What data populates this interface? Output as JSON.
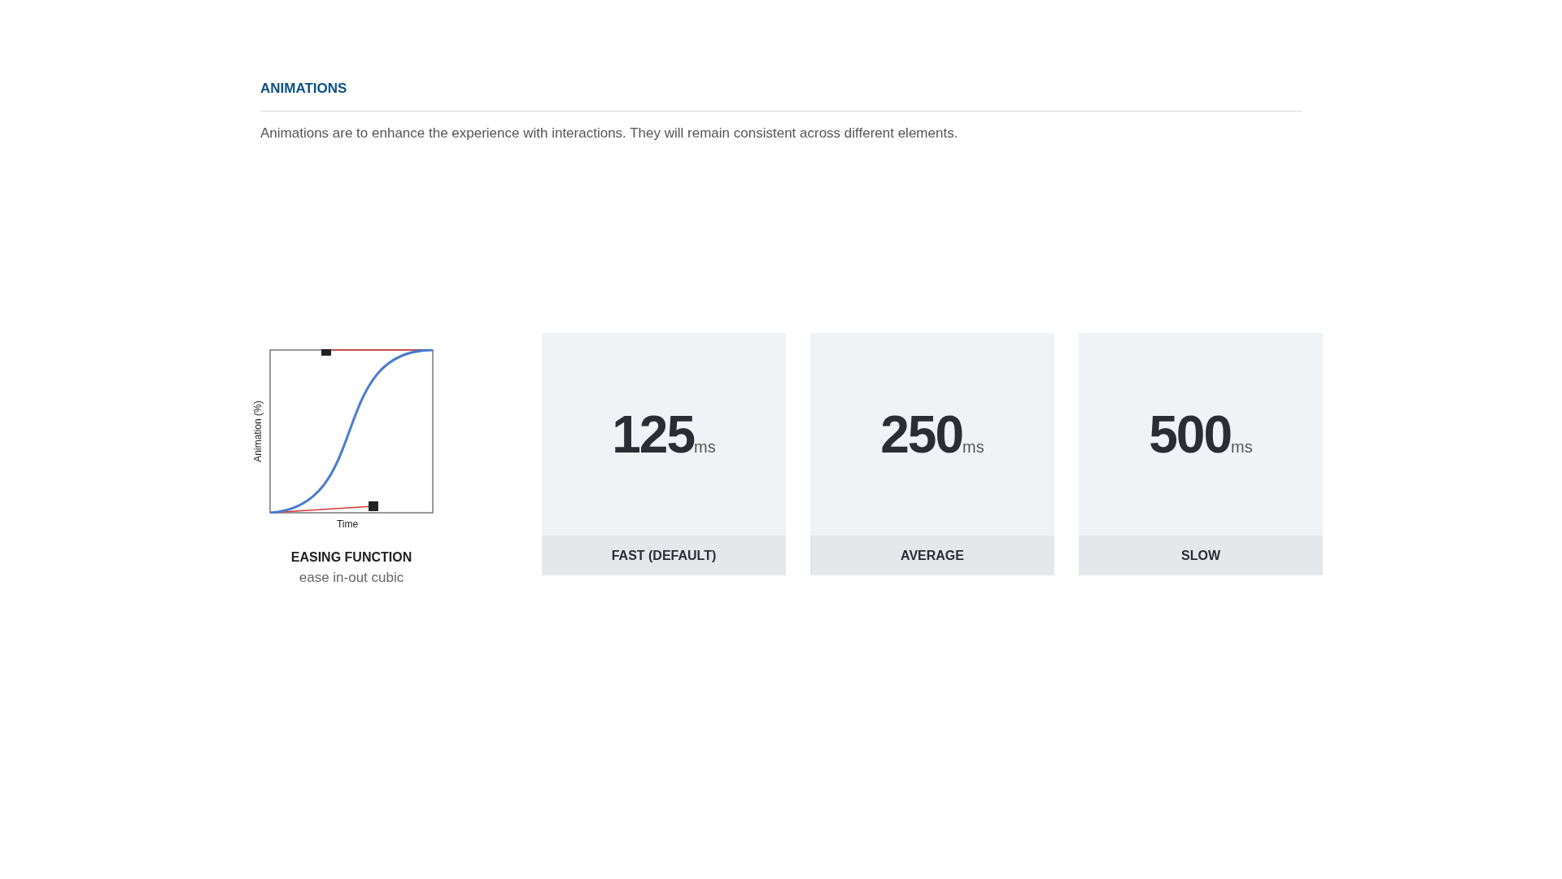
{
  "section": {
    "title": "ANIMATIONS",
    "description": "Animations are to enhance the experience with interactions. They will remain consistent across different elements."
  },
  "easing": {
    "ylabel": "Animation (%)",
    "xlabel": "Time",
    "title": "EASING FUNCTION",
    "subtitle": "ease in-out cubic"
  },
  "durations": [
    {
      "value": "125",
      "unit": "ms",
      "label": "FAST (DEFAULT)"
    },
    {
      "value": "250",
      "unit": "ms",
      "label": "AVERAGE"
    },
    {
      "value": "500",
      "unit": "ms",
      "label": "SLOW"
    }
  ]
}
